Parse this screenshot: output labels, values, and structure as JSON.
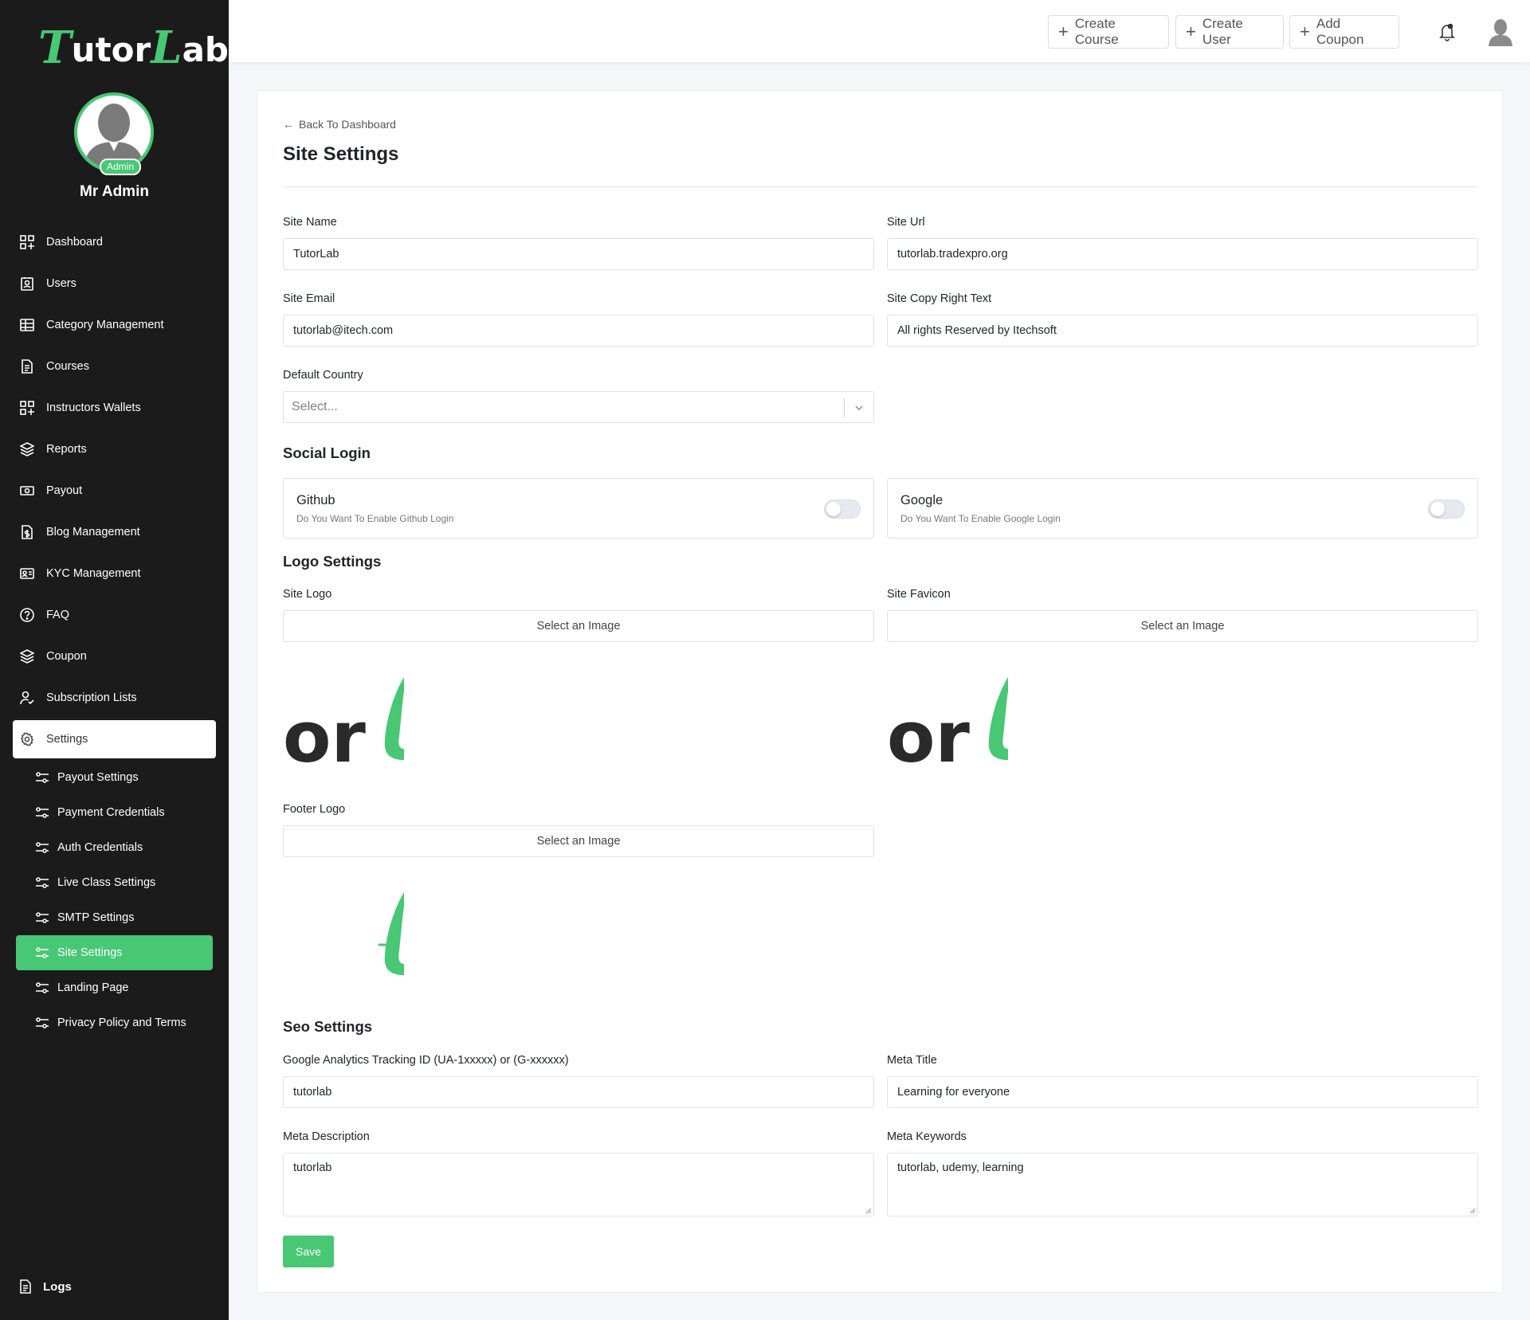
{
  "brand": {
    "logo_initial": "T",
    "logo_rest": "utor",
    "logo_l": "L",
    "logo_end": "ab",
    "accent": "#48c774"
  },
  "user": {
    "name": "Mr Admin",
    "role_badge": "Admin"
  },
  "sidebar": {
    "items": [
      {
        "label": "Dashboard",
        "icon": "grid-plus-icon"
      },
      {
        "label": "Users",
        "icon": "user-card-icon"
      },
      {
        "label": "Category Management",
        "icon": "table-icon"
      },
      {
        "label": "Courses",
        "icon": "document-icon"
      },
      {
        "label": "Instructors Wallets",
        "icon": "grid-plus-icon"
      },
      {
        "label": "Reports",
        "icon": "layers-icon"
      },
      {
        "label": "Payout",
        "icon": "cash-icon"
      },
      {
        "label": "Blog Management",
        "icon": "file-dollar-icon"
      },
      {
        "label": "KYC Management",
        "icon": "id-card-icon"
      },
      {
        "label": "FAQ",
        "icon": "question-icon"
      },
      {
        "label": "Coupon",
        "icon": "layers-icon"
      },
      {
        "label": "Subscription Lists",
        "icon": "user-check-icon"
      },
      {
        "label": "Settings",
        "icon": "gear-icon"
      }
    ],
    "sub_items": [
      {
        "label": "Payout Settings"
      },
      {
        "label": "Payment Credentials"
      },
      {
        "label": "Auth Credentials"
      },
      {
        "label": "Live Class Settings"
      },
      {
        "label": "SMTP Settings"
      },
      {
        "label": "Site Settings"
      },
      {
        "label": "Landing Page"
      },
      {
        "label": "Privacy Policy and Terms"
      }
    ],
    "logs_label": "Logs"
  },
  "topbar": {
    "create_course": "Create Course",
    "create_user": "Create User",
    "add_coupon": "Add Coupon"
  },
  "page": {
    "back_label": "Back To Dashboard",
    "title": "Site Settings"
  },
  "form": {
    "site_name_label": "Site Name",
    "site_name_value": "TutorLab",
    "site_url_label": "Site Url",
    "site_url_value": "tutorlab.tradexpro.org",
    "site_email_label": "Site Email",
    "site_email_value": "tutorlab@itech.com",
    "copyright_label": "Site Copy Right Text",
    "copyright_value": "All rights Reserved by Itechsoft",
    "country_label": "Default Country",
    "country_placeholder": "Select..."
  },
  "social": {
    "title": "Social Login",
    "github_title": "Github",
    "github_desc": "Do You Want To Enable Github Login",
    "github_enabled": false,
    "google_title": "Google",
    "google_desc": "Do You Want To Enable Google Login",
    "google_enabled": false
  },
  "logo_settings": {
    "title": "Logo Settings",
    "site_logo_label": "Site Logo",
    "site_favicon_label": "Site Favicon",
    "footer_logo_label": "Footer Logo",
    "select_image": "Select an Image",
    "preview_text": "or"
  },
  "seo": {
    "title": "Seo Settings",
    "ga_label": "Google Analytics Tracking ID (UA-1xxxxx) or (G-xxxxxx)",
    "ga_value": "tutorlab",
    "meta_title_label": "Meta Title",
    "meta_title_value": "Learning for everyone",
    "meta_desc_label": "Meta Description",
    "meta_desc_value": "tutorlab",
    "meta_keywords_label": "Meta Keywords",
    "meta_keywords_value": "tutorlab, udemy, learning"
  },
  "save_label": "Save"
}
